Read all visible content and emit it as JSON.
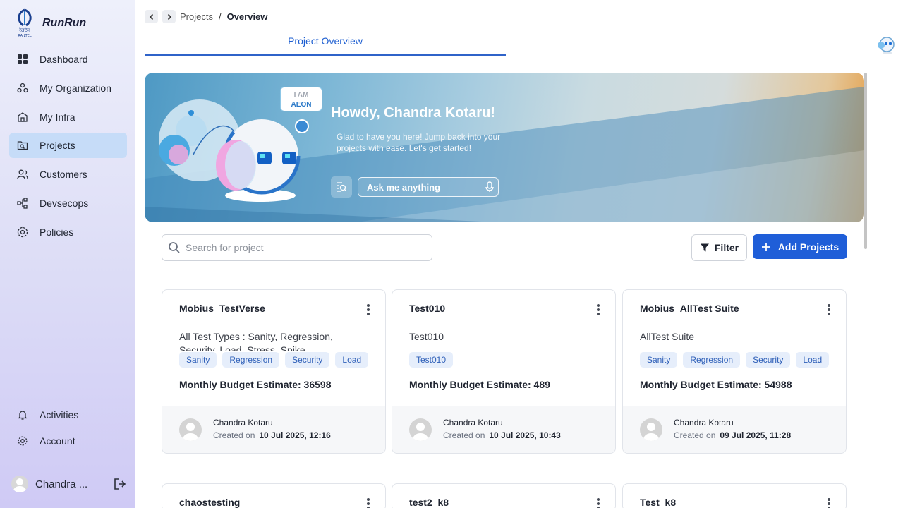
{
  "app": {
    "name": "RunRun",
    "logo_text": "रेलटेल RAILTEL"
  },
  "sidebar": {
    "items": [
      {
        "label": "Dashboard",
        "icon": "dashboard-icon"
      },
      {
        "label": "My Organization",
        "icon": "organization-icon"
      },
      {
        "label": "My Infra",
        "icon": "infra-icon"
      },
      {
        "label": "Projects",
        "icon": "projects-icon",
        "active": true
      },
      {
        "label": "Customers",
        "icon": "customers-icon"
      },
      {
        "label": "Devsecops",
        "icon": "devsecops-icon"
      },
      {
        "label": "Policies",
        "icon": "policies-icon"
      }
    ],
    "bottom_items": [
      {
        "label": "Activities",
        "icon": "bell-icon"
      },
      {
        "label": "Account",
        "icon": "gear-icon"
      }
    ],
    "user": {
      "name": "Chandra ..."
    }
  },
  "breadcrumb": {
    "parent": "Projects",
    "separator": "/",
    "current": "Overview"
  },
  "tabs": {
    "active": "Project Overview"
  },
  "banner": {
    "greeting": "Howdy, Chandra Kotaru!",
    "subtitle": "Glad to have you here! Jump back into your projects with ease. Let's get started!",
    "ask_placeholder": "Ask me anything",
    "bubble_line1": "I AM",
    "bubble_line2": "AEON"
  },
  "toolbar": {
    "search_placeholder": "Search for project",
    "filter_label": "Filter",
    "add_label": "Add Projects"
  },
  "projects": [
    {
      "title": "Mobius_TestVerse",
      "description": "All Test Types : Sanity, Regression, Security, Load, Stress, Spike",
      "tags": [
        "Sanity",
        "Regression",
        "Security",
        "Load"
      ],
      "budget": "Monthly Budget Estimate: 36598",
      "owner": "Chandra Kotaru",
      "created_label": "Created on",
      "created": "10 Jul 2025, 12:16"
    },
    {
      "title": "Test010",
      "description": "Test010",
      "tags": [
        "Test010"
      ],
      "budget": "Monthly Budget Estimate: 489",
      "owner": "Chandra Kotaru",
      "created_label": "Created on",
      "created": "10 Jul 2025, 10:43"
    },
    {
      "title": "Mobius_AllTest Suite",
      "description": "AllTest Suite",
      "tags": [
        "Sanity",
        "Regression",
        "Security",
        "Load"
      ],
      "budget": "Monthly Budget Estimate: 54988",
      "owner": "Chandra Kotaru",
      "created_label": "Created on",
      "created": "09 Jul 2025, 11:28"
    },
    {
      "title": "chaostesting"
    },
    {
      "title": "test2_k8"
    },
    {
      "title": "Test_k8"
    }
  ],
  "colors": {
    "accent": "#1f5ed8",
    "active_nav": "#c6dcf8",
    "tag_bg": "#e6eefb"
  }
}
